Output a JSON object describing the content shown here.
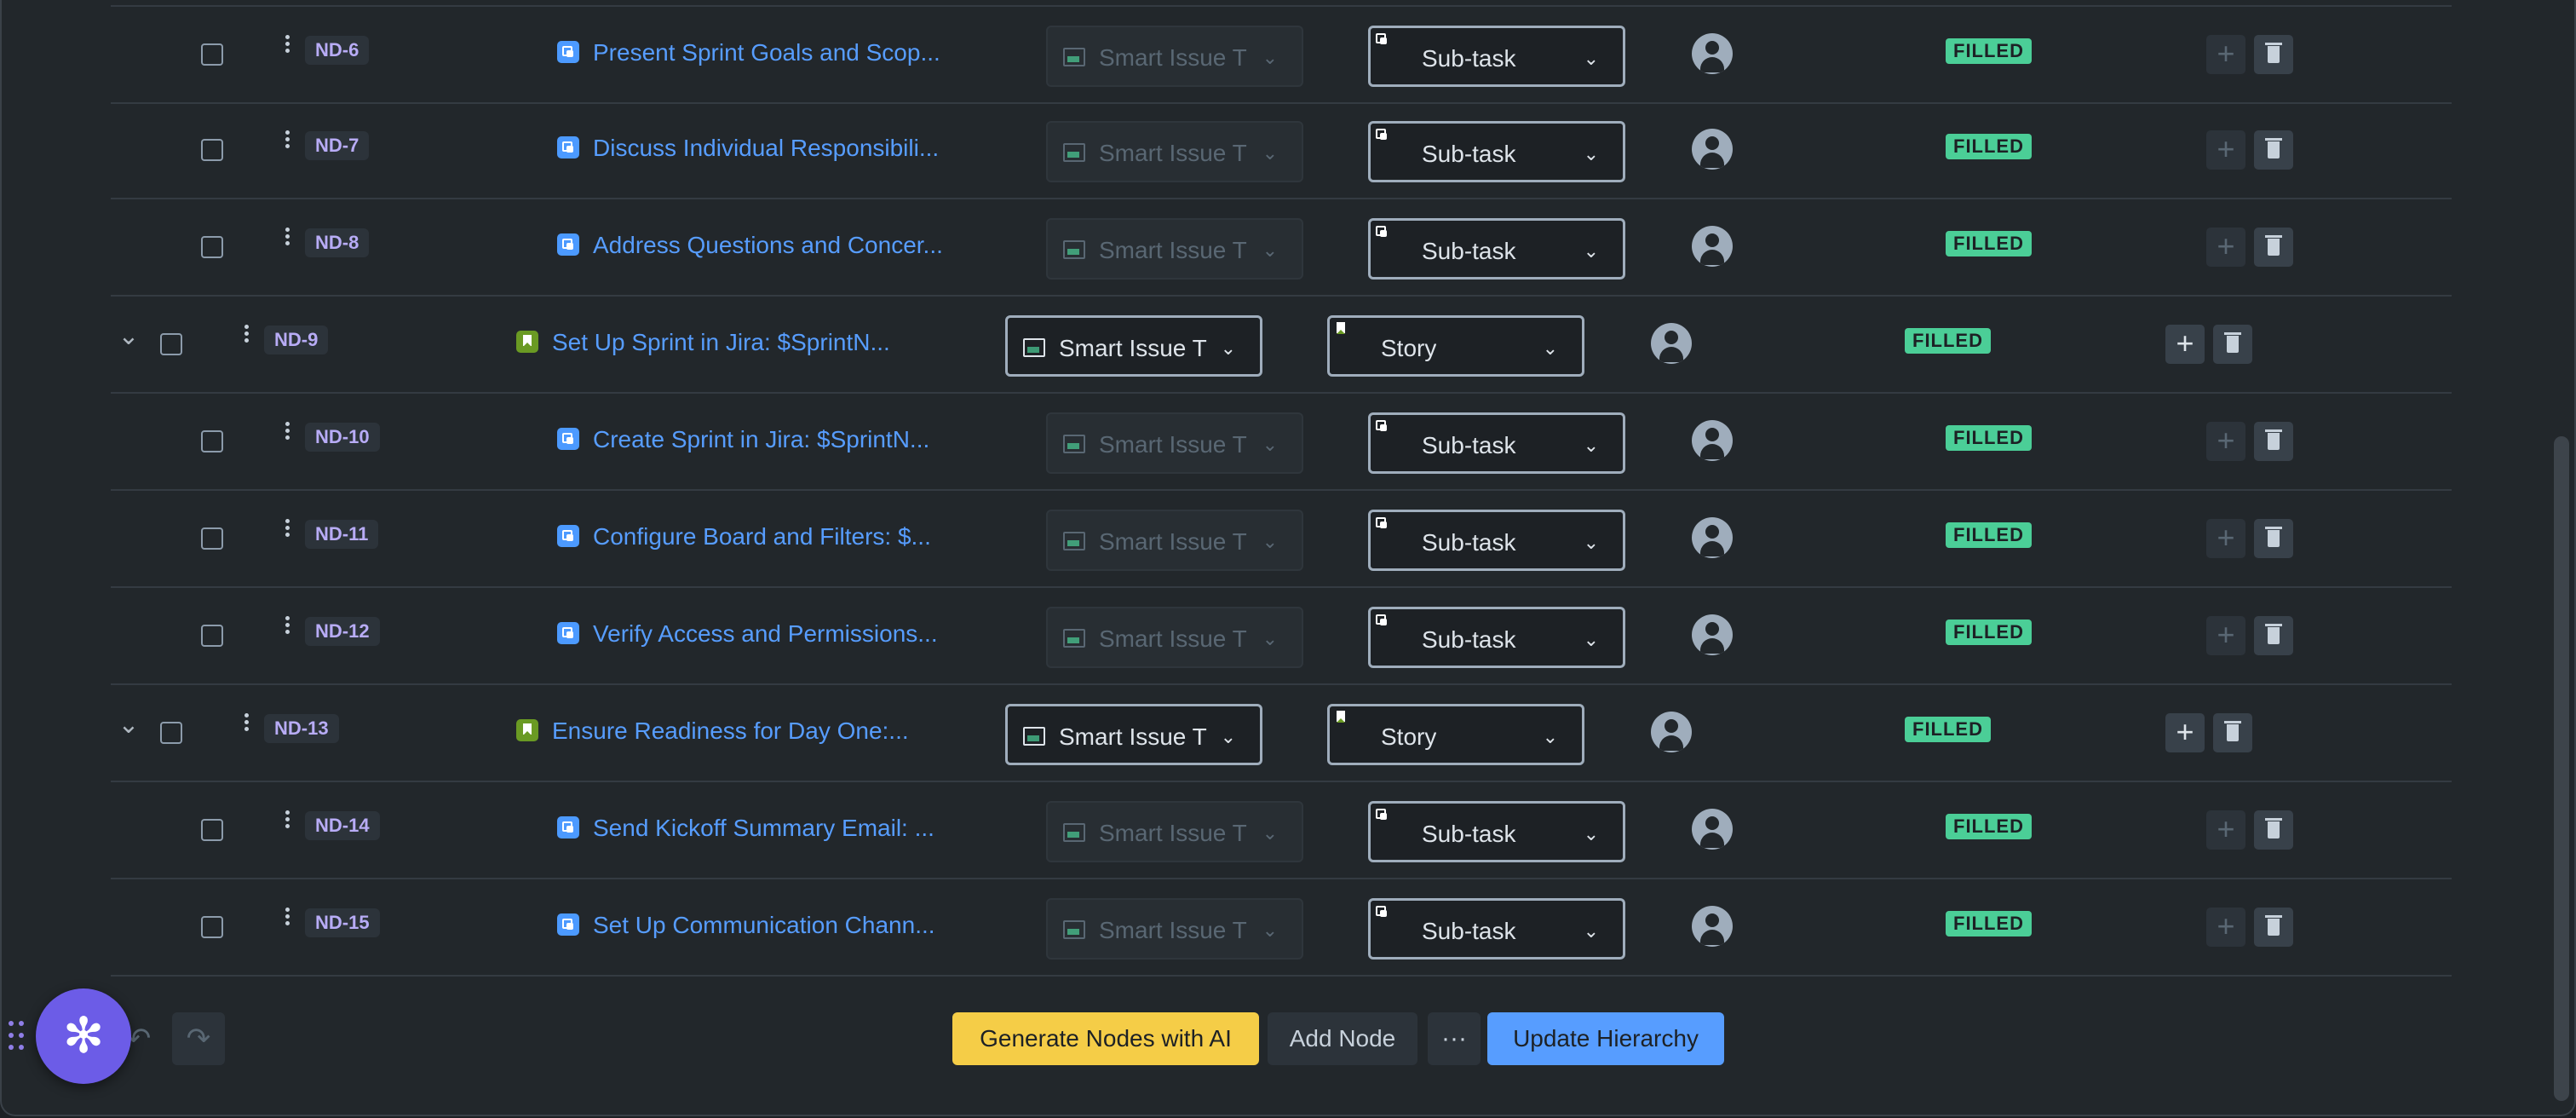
{
  "smart_select_label": "Smart Issue T",
  "filled_label": "FILLED",
  "rows": [
    {
      "key": "ND-6",
      "summary": "Present Sprint Goals and Scop...",
      "type": "Sub-task",
      "level": "child"
    },
    {
      "key": "ND-7",
      "summary": "Discuss Individual Responsibili...",
      "type": "Sub-task",
      "level": "child"
    },
    {
      "key": "ND-8",
      "summary": "Address Questions and Concer...",
      "type": "Sub-task",
      "level": "child"
    },
    {
      "key": "ND-9",
      "summary": "Set Up Sprint in Jira: $SprintN...",
      "type": "Story",
      "level": "parent"
    },
    {
      "key": "ND-10",
      "summary": "Create Sprint in Jira: $SprintN...",
      "type": "Sub-task",
      "level": "child"
    },
    {
      "key": "ND-11",
      "summary": "Configure Board and Filters: $...",
      "type": "Sub-task",
      "level": "child"
    },
    {
      "key": "ND-12",
      "summary": "Verify Access and Permissions...",
      "type": "Sub-task",
      "level": "child"
    },
    {
      "key": "ND-13",
      "summary": "Ensure Readiness for Day One:...",
      "type": "Story",
      "level": "parent"
    },
    {
      "key": "ND-14",
      "summary": "Send Kickoff Summary Email: ...",
      "type": "Sub-task",
      "level": "child"
    },
    {
      "key": "ND-15",
      "summary": "Set Up Communication Chann...",
      "type": "Sub-task",
      "level": "child"
    }
  ],
  "footer": {
    "generate_label": "Generate Nodes with AI",
    "add_node_label": "Add Node",
    "more_label": "···",
    "update_label": "Update Hierarchy"
  }
}
